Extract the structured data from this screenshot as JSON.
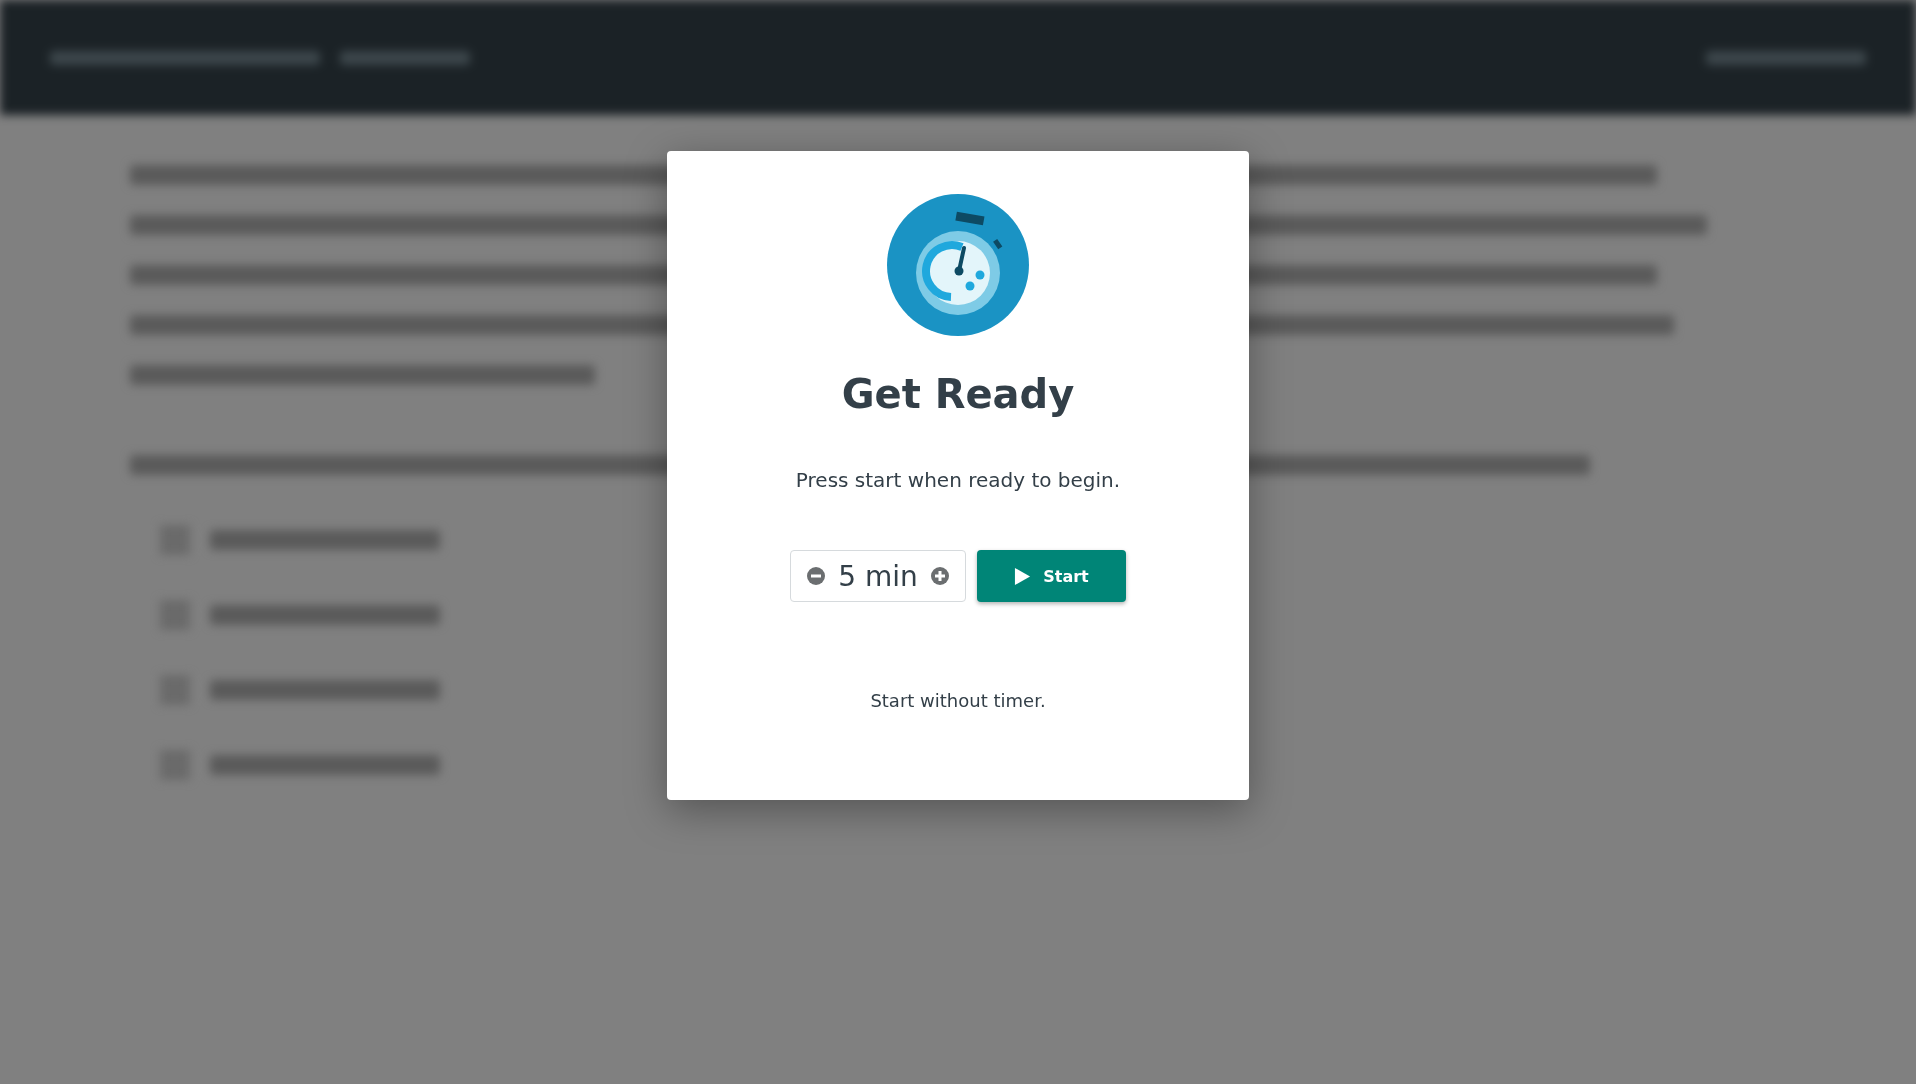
{
  "modal": {
    "title": "Get Ready",
    "message": "Press start when ready to begin.",
    "timer": {
      "value": "5 min"
    },
    "start_button": "Start",
    "skip_link": "Start without timer."
  }
}
